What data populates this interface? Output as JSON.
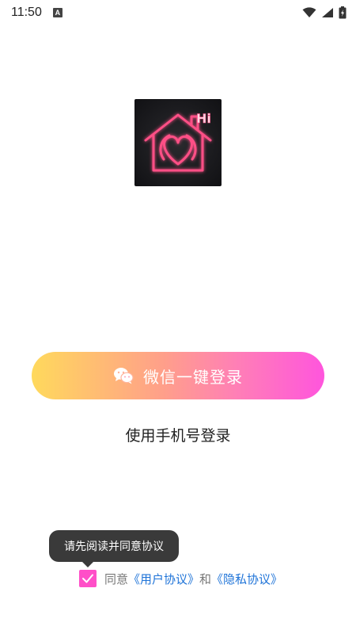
{
  "status_bar": {
    "time": "11:50",
    "badge_letter": "A"
  },
  "colors": {
    "accent_pink": "#ff4fc8",
    "gradient_start": "#ffd95c",
    "gradient_end": "#ff55dd",
    "link_blue": "#1e73d8",
    "tooltip_bg": "#3a3a3a"
  },
  "logo": {
    "hi_text": "Hi"
  },
  "wechat_button": {
    "label": "微信一键登录",
    "icon": "wechat-icon"
  },
  "phone_login": {
    "label": "使用手机号登录"
  },
  "tooltip": {
    "text": "请先阅读并同意协议"
  },
  "agreement": {
    "checked": true,
    "prefix": "同意",
    "user_agreement": "《用户协议》",
    "conjunction": "和",
    "privacy_agreement": "《隐私协议》"
  }
}
